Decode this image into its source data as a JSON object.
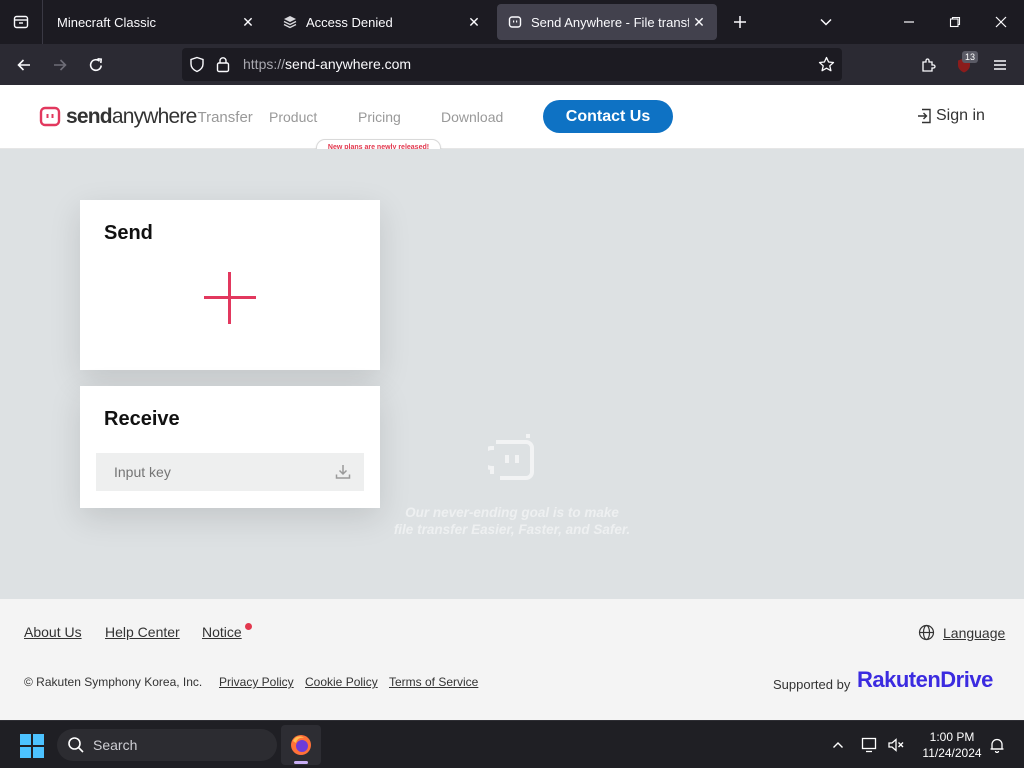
{
  "browser": {
    "tabs": [
      {
        "title": "Minecraft Classic",
        "active": false
      },
      {
        "title": "Access Denied",
        "active": false
      },
      {
        "title": "Send Anywhere - File transfer",
        "active": true
      }
    ],
    "url_scheme": "https://",
    "url_host": "send-anywhere.com",
    "extension_badge": "13"
  },
  "site": {
    "logo": {
      "send": "send",
      "anywhere": "anywhere",
      "transfer": "Transfer"
    },
    "nav": {
      "product": "Product",
      "pricing": "Pricing",
      "download": "Download"
    },
    "pricing_badge": "New plans are newly released!",
    "contact_label": "Contact Us",
    "signin_label": "Sign in",
    "send_card": {
      "title": "Send"
    },
    "receive_card": {
      "title": "Receive",
      "input_placeholder": "Input key"
    },
    "tagline_line1": "Our never-ending goal is to make",
    "tagline_line2": "file transfer Easier, Faster, and Safer.",
    "footer": {
      "about": "About Us",
      "help": "Help Center",
      "notice": "Notice",
      "language": "Language",
      "copyright": "© Rakuten Symphony Korea, Inc.",
      "privacy": "Privacy Policy",
      "cookie": "Cookie Policy",
      "terms": "Terms of Service",
      "supported_by": "Supported by",
      "brand_1": "Rakuten",
      "brand_2": "Drive"
    }
  },
  "taskbar": {
    "search_label": "Search",
    "time": "1:00 PM",
    "date": "11/24/2024"
  },
  "colors": {
    "accent_pink": "#e2385e",
    "contact_blue": "#0e72c4",
    "hero_bg": "#dde1e3"
  }
}
